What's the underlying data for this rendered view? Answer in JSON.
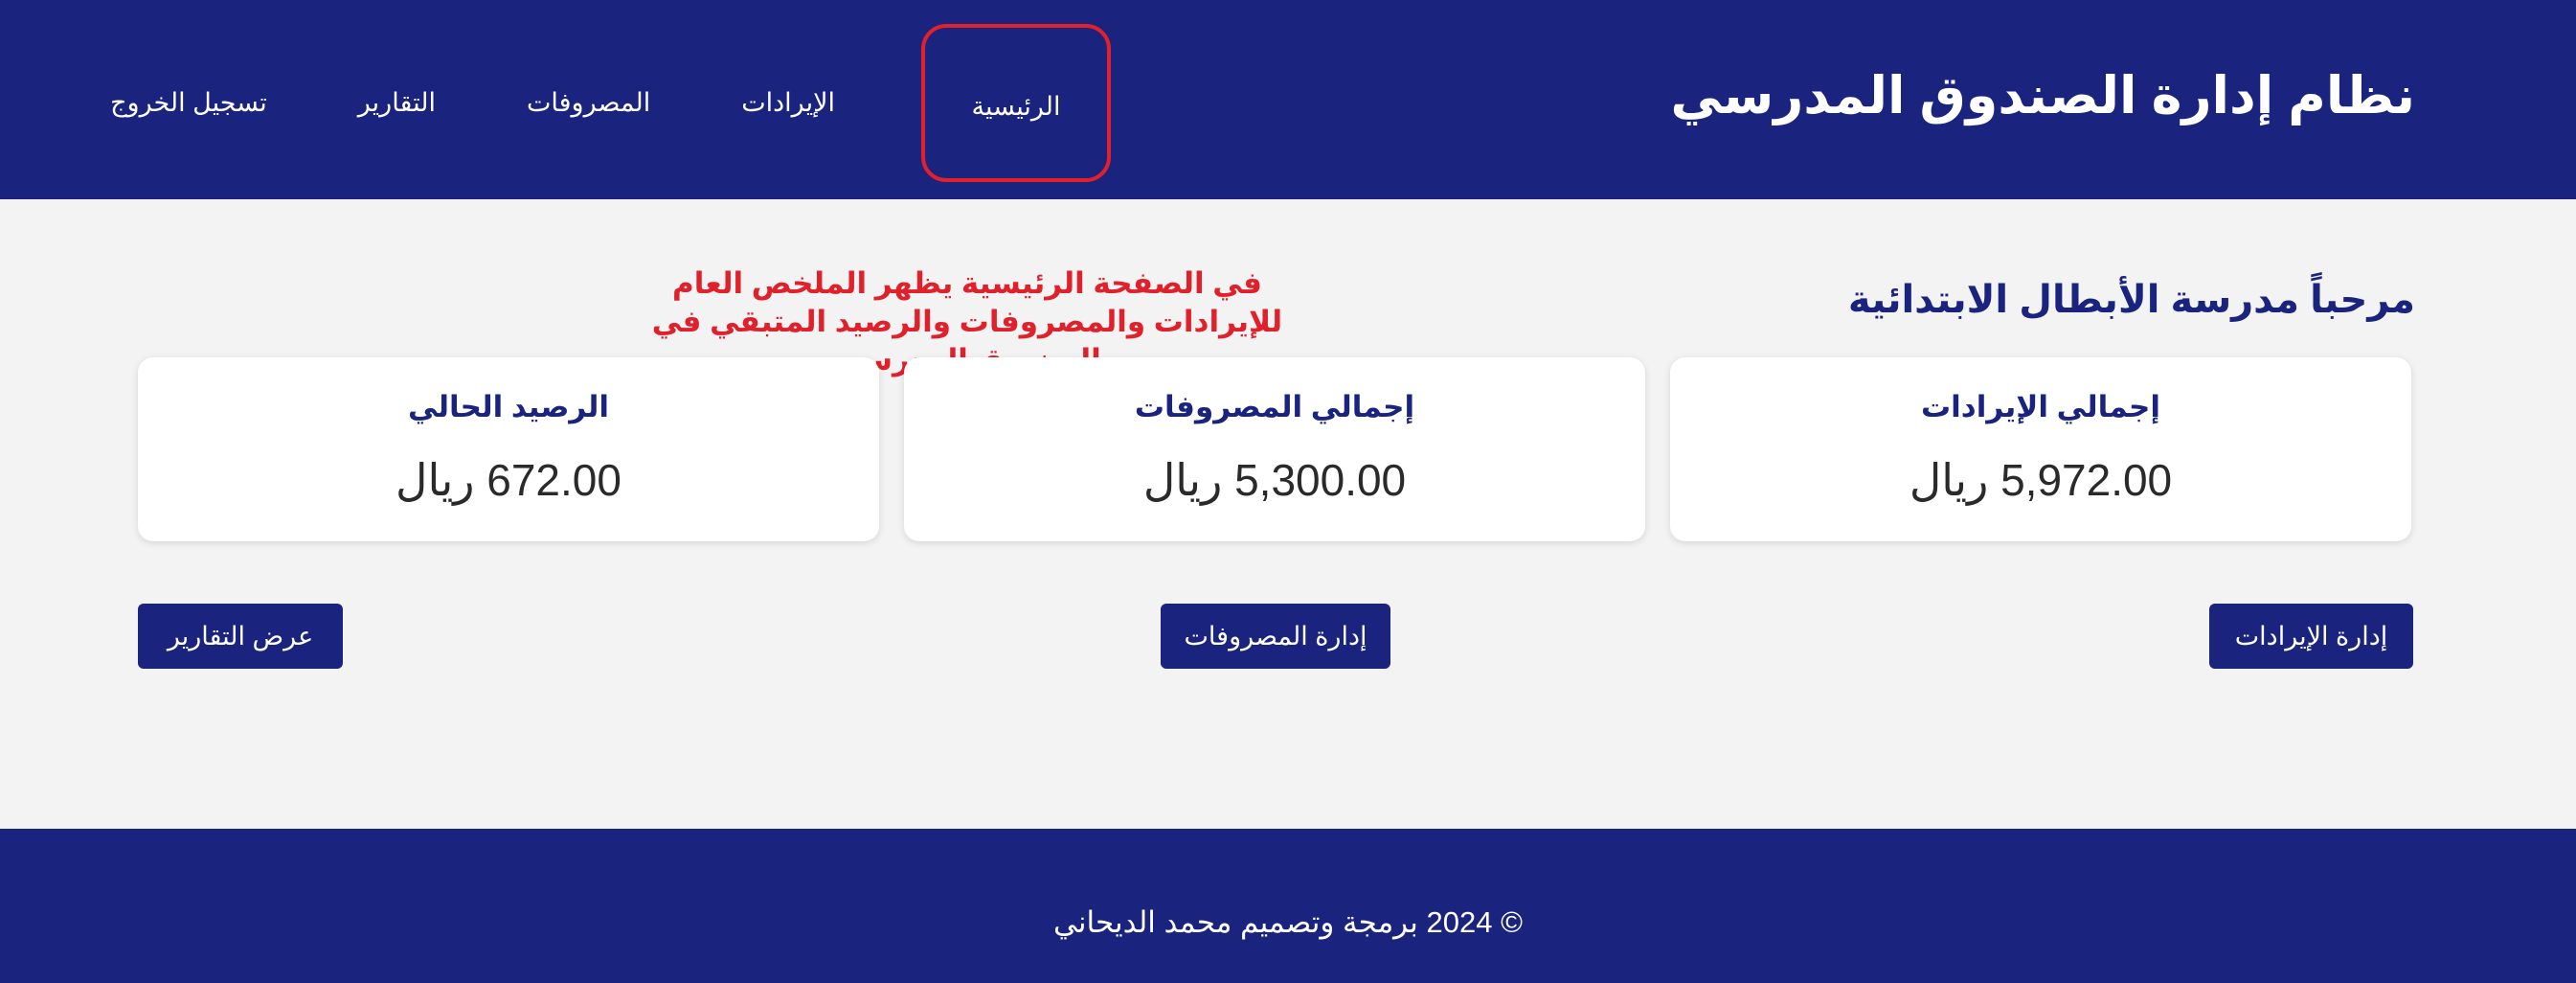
{
  "header": {
    "title": "نظام إدارة الصندوق المدرسي",
    "nav": [
      {
        "label": "الرئيسية",
        "active": true
      },
      {
        "label": "الإيرادات",
        "active": false
      },
      {
        "label": "المصروفات",
        "active": false
      },
      {
        "label": "التقارير",
        "active": false
      },
      {
        "label": "تسجيل الخروج",
        "active": false
      }
    ]
  },
  "main": {
    "welcome": "مرحباً مدرسة الأبطال الابتدائية",
    "annotation": "في الصفحة الرئيسية يظهر الملخص العام للإيرادات والمصروفات والرصيد المتبقي في الصندوق المدرسي",
    "cards": [
      {
        "title": "إجمالي الإيرادات",
        "value": "5,972.00 ريال"
      },
      {
        "title": "إجمالي المصروفات",
        "value": "5,300.00 ريال"
      },
      {
        "title": "الرصيد الحالي",
        "value": "672.00 ريال"
      }
    ],
    "buttons": {
      "revenues": "إدارة الإيرادات",
      "expenses": "إدارة المصروفات",
      "reports": "عرض التقارير"
    }
  },
  "footer": {
    "text": "© 2024 برمجة وتصميم محمد الديحاني"
  },
  "colors": {
    "primary": "#1a237e",
    "annotation": "#e0202a",
    "background": "#f3f3f3"
  }
}
